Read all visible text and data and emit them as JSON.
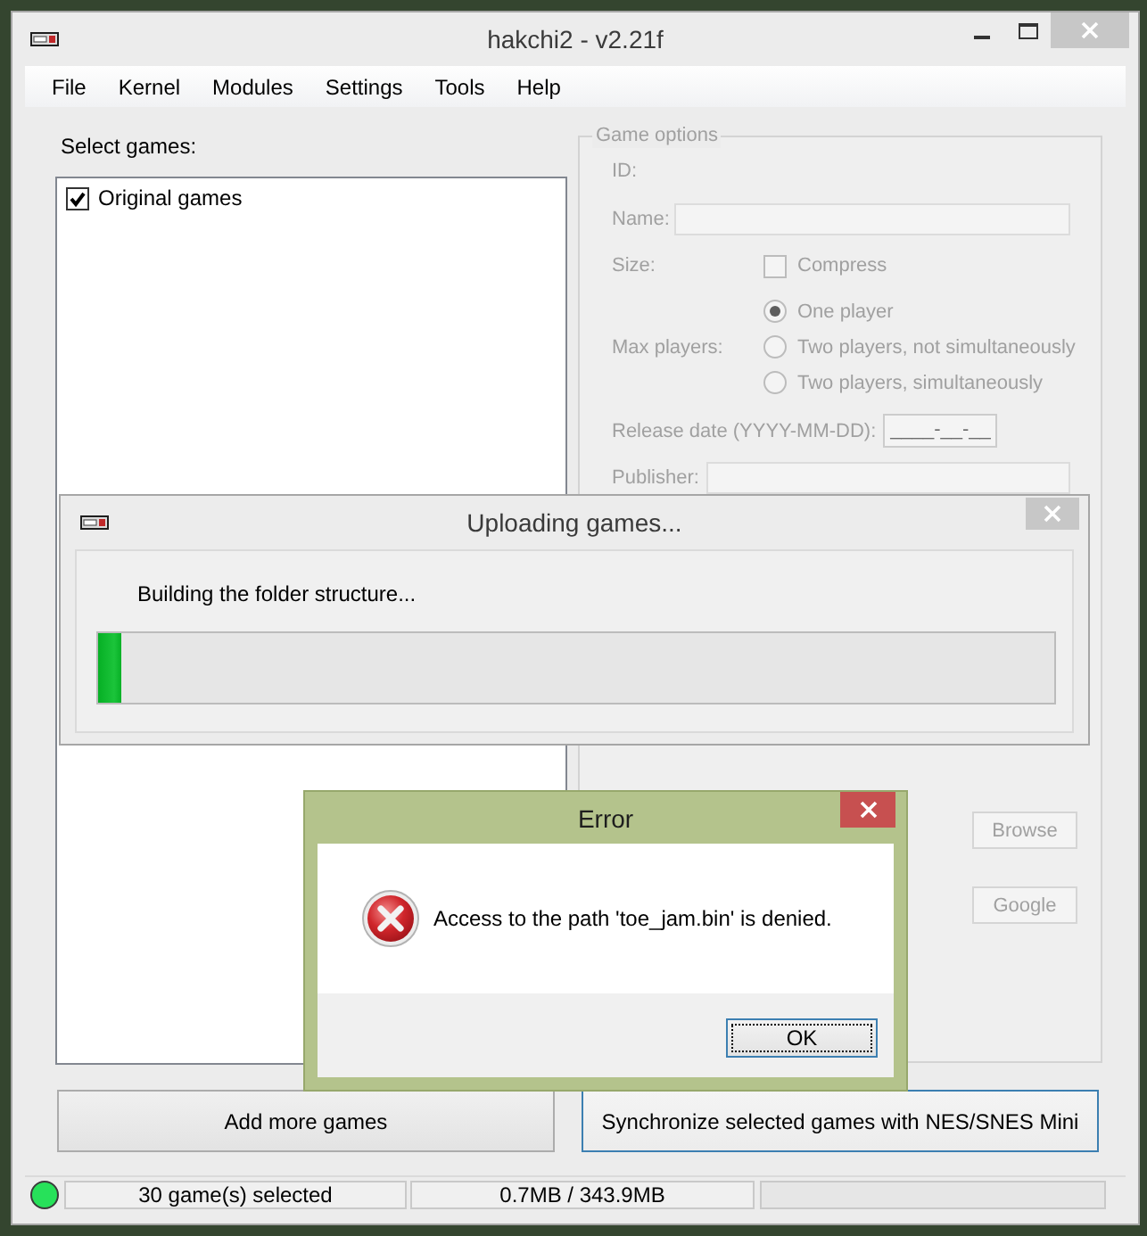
{
  "main_window": {
    "title": "hakchi2 - v2.21f",
    "active": false,
    "menu": [
      "File",
      "Kernel",
      "Modules",
      "Settings",
      "Tools",
      "Help"
    ],
    "games_list": {
      "label": "Select games:",
      "items": [
        {
          "label": "Original games",
          "checked": true
        }
      ]
    },
    "game_options": {
      "title": "Game options",
      "disabled": true,
      "id": {
        "label": "ID:"
      },
      "name": {
        "label": "Name:"
      },
      "size": {
        "label": "Size:",
        "compress": {
          "label": "Compress",
          "checked": false
        }
      },
      "max_players": {
        "label": "Max players:",
        "options": [
          {
            "label": "One player",
            "selected": true
          },
          {
            "label": "Two players, not simultaneously",
            "selected": false
          },
          {
            "label": "Two players, simultaneously",
            "selected": false
          }
        ]
      },
      "release_date": {
        "label": "Release date (YYYY-MM-DD):",
        "value": "____-__-__"
      },
      "publisher": {
        "label": "Publisher:"
      },
      "buttons": [
        "Browse",
        "Google"
      ]
    },
    "buttons": [
      {
        "label": "Add more games",
        "focused": false
      },
      {
        "label": "Synchronize selected games with NES/SNES Mini",
        "focused": true
      }
    ],
    "status_bar": {
      "console_connected": true,
      "panels": [
        "30 game(s) selected",
        "0.7MB / 343.9MB"
      ]
    }
  },
  "upload_dialog": {
    "title": "Uploading games...",
    "active": false,
    "status": "Building the folder structure...",
    "progress": {
      "level": 0.024
    }
  },
  "error_dialog": {
    "title": "Error",
    "active": true,
    "message": "Access to the path 'toe_jam.bin' is denied.",
    "buttons": [
      {
        "label": "OK",
        "focused": true
      }
    ]
  }
}
